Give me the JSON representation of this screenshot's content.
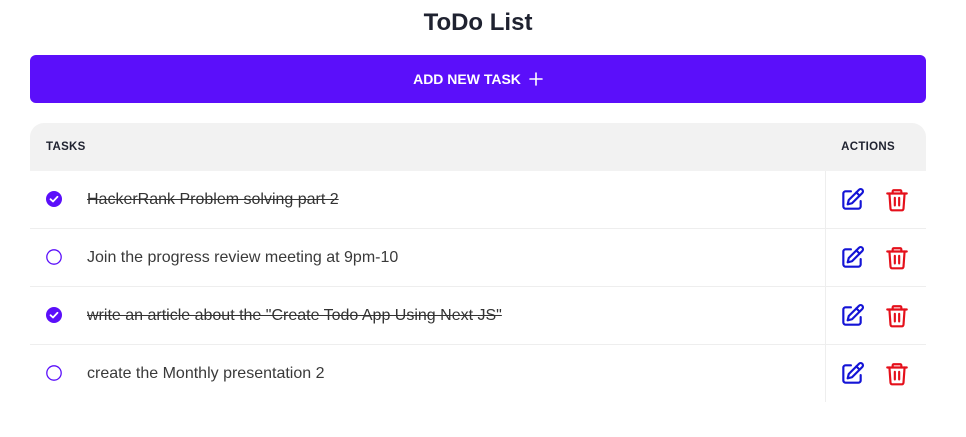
{
  "app": {
    "title": "ToDo List"
  },
  "add_button": {
    "label": "ADD NEW TASK",
    "icon": "plus-icon"
  },
  "table": {
    "headers": {
      "tasks": "TASKS",
      "actions": "ACTIONS"
    },
    "rows": [
      {
        "text": "HackerRank Problem solving part 2",
        "completed": true
      },
      {
        "text": "Join the progress review meeting at 9pm-10",
        "completed": false
      },
      {
        "text": "write an article about the \"Create Todo App Using Next JS\"",
        "completed": true
      },
      {
        "text": "create the Monthly presentation 2",
        "completed": false
      }
    ],
    "row_actions": {
      "edit_icon": "edit-icon",
      "delete_icon": "trash-icon"
    }
  },
  "colors": {
    "accent": "#5b0ffa",
    "edit": "#1414d6",
    "delete": "#e5101b",
    "header_bg": "#f2f2f2",
    "title": "#1f2230"
  }
}
